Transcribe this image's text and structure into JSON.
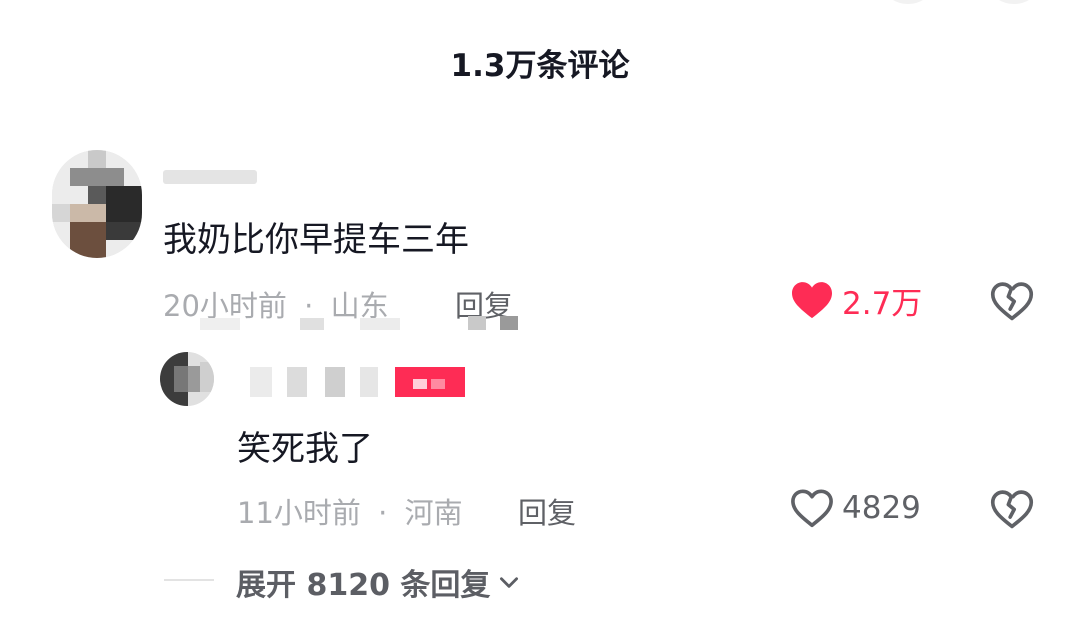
{
  "header": {
    "title": "1.3万条评论"
  },
  "comments": [
    {
      "text": "我奶比你早提车三年",
      "time": "20小时前",
      "separator": "·",
      "location": "山东",
      "reply_label": "回复",
      "likes": "2.7万",
      "liked": true,
      "like_color": "#fe2c55",
      "like_icon": "heart-filled-icon",
      "dislike_icon": "broken-heart-icon",
      "replies": [
        {
          "text": "笑死我了",
          "time": "11小时前",
          "separator": "·",
          "location": "河南",
          "reply_label": "回复",
          "likes": "4829",
          "liked": false,
          "like_icon": "heart-outline-icon",
          "dislike_icon": "broken-heart-icon",
          "badge_color": "#fe2c55"
        }
      ]
    }
  ],
  "expand": {
    "label": "展开 8120 条回复",
    "icon": "chevron-down-icon"
  }
}
